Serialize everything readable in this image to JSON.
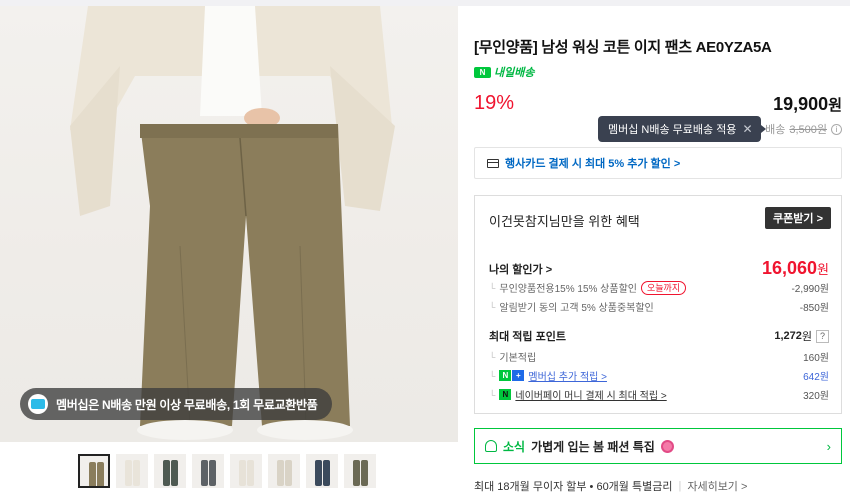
{
  "image": {
    "promo_text": "멤버십은 N배송 만원 이상 무료배송, 1회 무료교환반품",
    "thumbnails": [
      {
        "label": "thumb-1",
        "color": "#8a7d5c",
        "active": true
      },
      {
        "label": "thumb-2",
        "color": "#e9e4da",
        "active": false
      },
      {
        "label": "thumb-3",
        "color": "#4e5a52",
        "active": false
      },
      {
        "label": "thumb-4",
        "color": "#5d6266",
        "active": false
      },
      {
        "label": "thumb-5",
        "color": "#e7e2d8",
        "active": false
      },
      {
        "label": "thumb-6",
        "color": "#d9d3c6",
        "active": false
      },
      {
        "label": "thumb-7",
        "color": "#3b4a5c",
        "active": false
      },
      {
        "label": "thumb-8",
        "color": "#6b6a55",
        "active": false
      }
    ]
  },
  "product": {
    "title": "[무인양품] 남성 워싱 코튼 이지 팬츠 AE0YZA5A",
    "delivery_label": "내일배송",
    "discount_rate": "19%",
    "price": "19,900",
    "price_unit": "원",
    "tooltip": "멤버십 N배송 무료배송 적용",
    "shipping_prefix": "배송",
    "shipping_fee": "3,500원"
  },
  "card_banner": "행사카드 결제 시 최대 5% 추가 할인 >",
  "benefit": {
    "title": "이건못참지님만을 위한 혜택",
    "coupon_button": "쿠폰받기 >",
    "my_discount_label": "나의 할인가 >",
    "my_discount_price": "16,060",
    "my_discount_unit": "원",
    "discount_rows": [
      {
        "label": "무인양품전용15% 15% 상품할인",
        "tag": "오늘까지",
        "value": "-2,990원"
      },
      {
        "label": "알림받기 동의 고객 5% 상품중복할인",
        "tag": "",
        "value": "-850원"
      }
    ],
    "points_label": "최대 적립 포인트",
    "points_value": "1,272",
    "points_unit": "원",
    "point_rows": [
      {
        "label": "기본적립",
        "value": "160원"
      },
      {
        "label": "멤버십 추가 적립 >",
        "value": "642원"
      },
      {
        "label": "네이버페이 머니 결제 시 최대 적립 >",
        "value": "320원"
      }
    ]
  },
  "news_banner": {
    "keyword": "소식",
    "text": "가볍게 입는 봄 패션 특집"
  },
  "installment": {
    "text": "최대 18개월 무이자 할부 • 60개월 특별금리",
    "link": "자세히보기 >"
  },
  "colors": {
    "sale_red": "#f0142f",
    "naver_green": "#00c73c",
    "link_blue": "#3d66d8"
  }
}
